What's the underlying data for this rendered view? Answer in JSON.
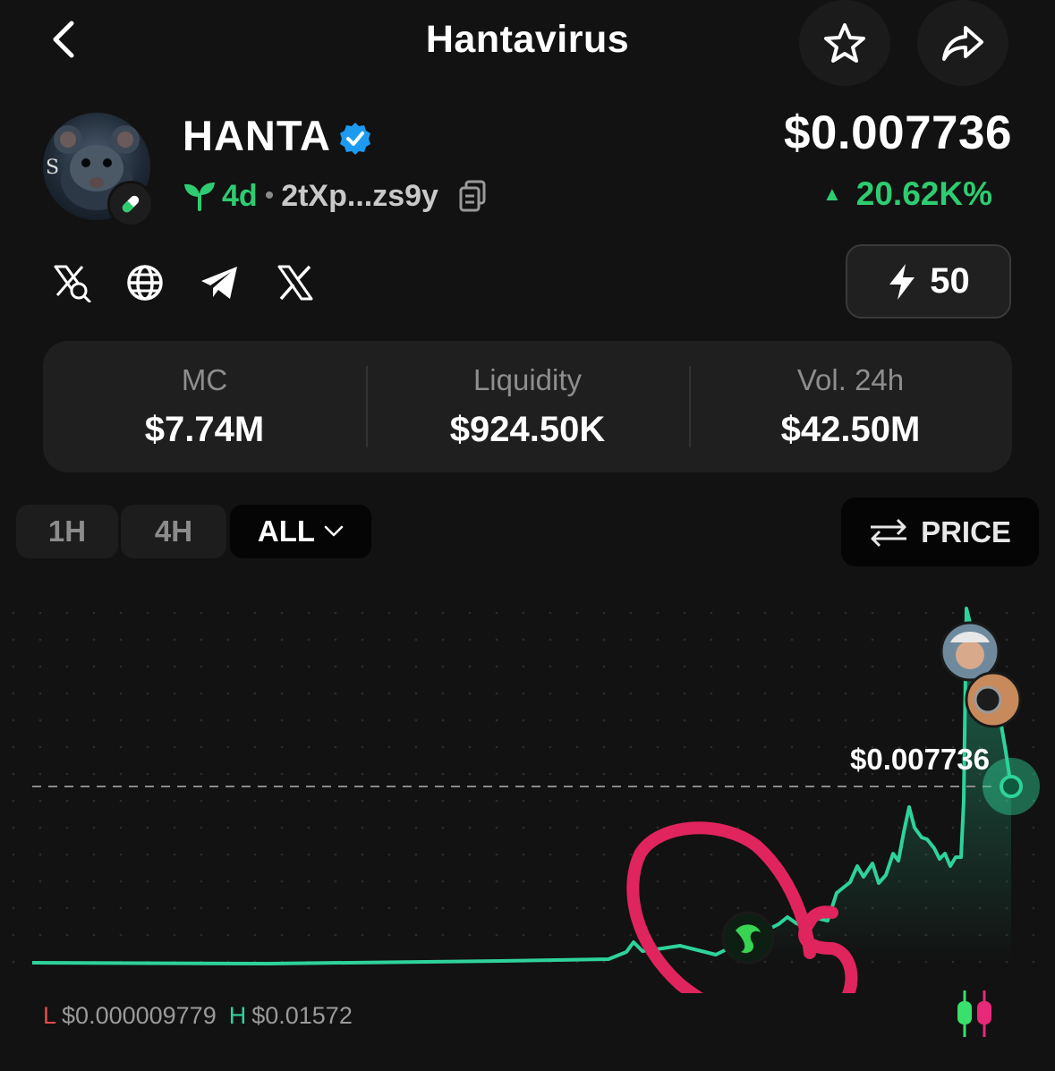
{
  "header": {
    "title": "Hantavirus"
  },
  "token": {
    "symbol": "HANTA",
    "age": "4d",
    "address": "2tXp...zs9y",
    "price": "$0.007736",
    "change": "20.62K%"
  },
  "boost": {
    "label": "50"
  },
  "stats": [
    {
      "label": "MC",
      "value": "$7.74M"
    },
    {
      "label": "Liquidity",
      "value": "$924.50K"
    },
    {
      "label": "Vol. 24h",
      "value": "$42.50M"
    }
  ],
  "timeframes": [
    "1H",
    "4H",
    "ALL"
  ],
  "price_toggle": "PRICE",
  "chart": {
    "current_price_label": "$0.007736",
    "low_key": "L",
    "low_value": "$0.000009779",
    "high_key": "H",
    "high_value": "$0.01572"
  },
  "colors": {
    "accent_green": "#2ecc71",
    "line_green": "#2ed39a",
    "verified_blue": "#1d9bf0",
    "low_red": "#e44d4d",
    "annotation_pink": "#e0245e"
  },
  "icons": [
    "back-icon",
    "star-icon",
    "share-icon",
    "verified-icon",
    "sprout-icon",
    "copy-icon",
    "x-search-icon",
    "globe-icon",
    "telegram-icon",
    "x-logo-icon",
    "lightning-icon",
    "swap-icon",
    "chevron-down-icon",
    "candlestick-icon"
  ]
}
